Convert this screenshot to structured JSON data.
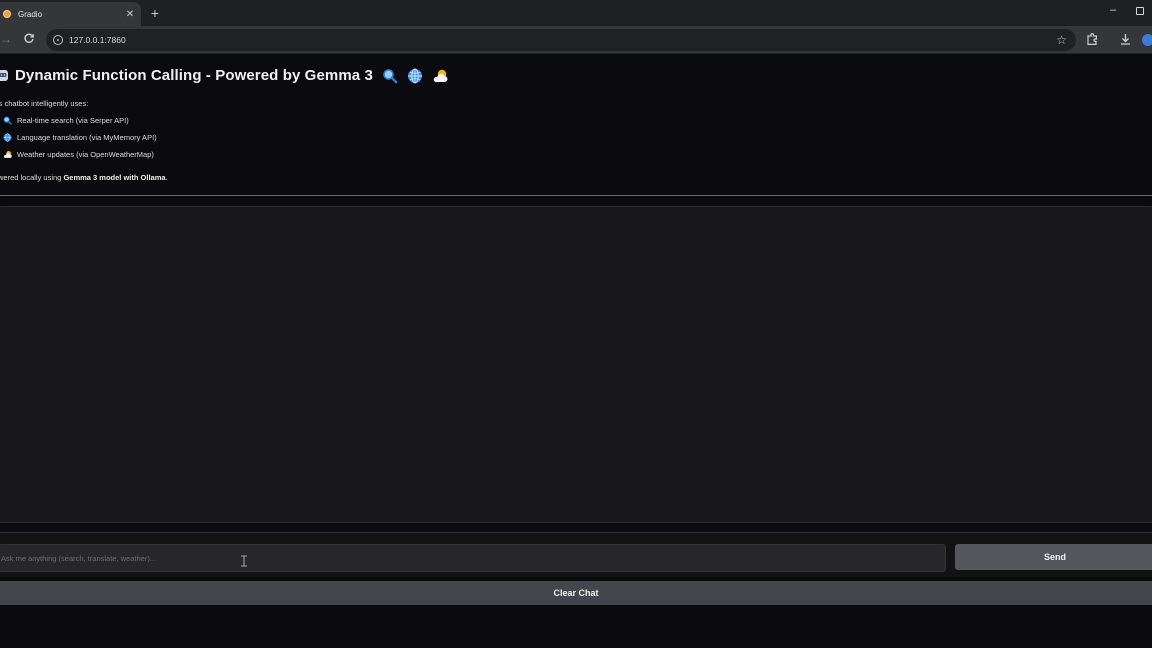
{
  "browser": {
    "tab_title": "Gradio",
    "tab_close": "✕",
    "new_tab": "+",
    "window_minimize": "–",
    "nav_forward": "→",
    "url": "127.0.0.1:7860",
    "bookmark_star": "☆"
  },
  "header": {
    "title": "Dynamic Function Calling - Powered by Gemma 3"
  },
  "description": {
    "intro": "is chatbot intelligently uses:",
    "features": [
      {
        "icon": "search-icon",
        "label": "Real-time search (via Serper API)"
      },
      {
        "icon": "globe-icon",
        "label": "Language translation (via MyMemory API)"
      },
      {
        "icon": "weather-icon",
        "label": "Weather updates (via OpenWeatherMap)"
      }
    ],
    "footer_prefix": "wered locally using ",
    "footer_bold": "Gemma 3 model with Ollama",
    "footer_suffix": "."
  },
  "chat": {
    "input_placeholder": "Ask me anything (search, translate, weather)...",
    "send_label": "Send",
    "clear_label": "Clear Chat"
  },
  "colors": {
    "background": "#0b0b0f",
    "chatbox": "#18181b",
    "send_button": "#55565c",
    "clear_button": "#45464b"
  }
}
